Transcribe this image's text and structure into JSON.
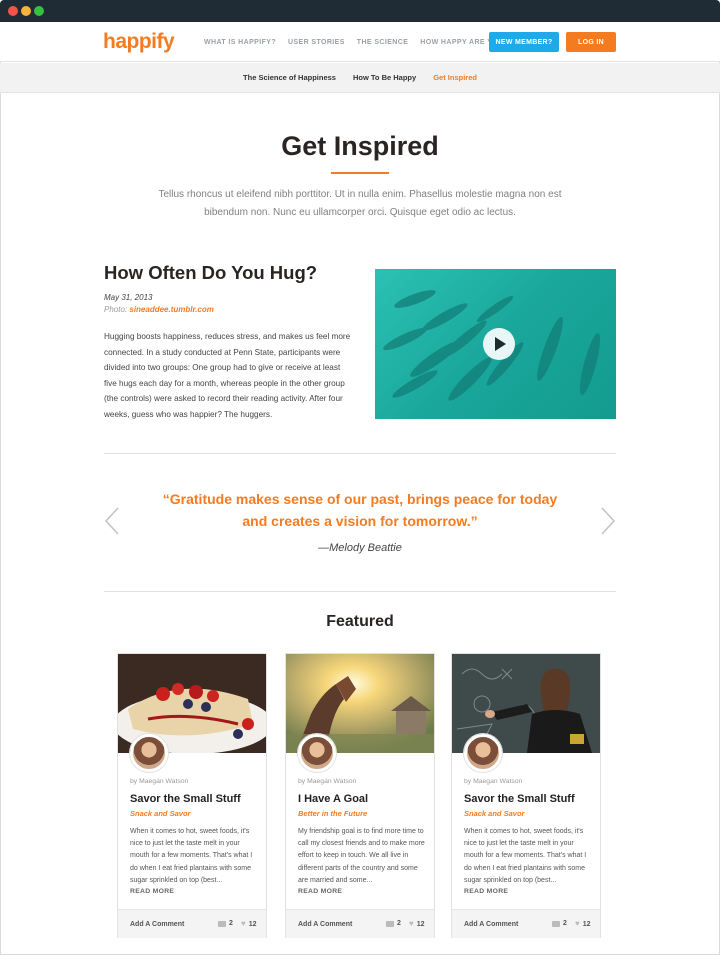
{
  "header": {
    "logo": "happify",
    "nav": [
      "WHAT IS HAPPIFY?",
      "USER STORIES",
      "THE SCIENCE",
      "HOW HAPPY ARE YOU?"
    ],
    "new_member_label": "NEW MEMBER?",
    "login_label": "LOG IN",
    "accent": "#f47b20",
    "blue": "#1ea9e8"
  },
  "subnav": [
    "The Science of Happiness",
    "How To Be Happy",
    "Get Inspired"
  ],
  "page": {
    "title": "Get Inspired",
    "intro": "Tellus rhoncus ut eleifend nibh porttitor. Ut in nulla enim. Phasellus molestie magna non est bibendum non. Nunc eu ullamcorper orci. Quisque eget odio ac lectus."
  },
  "article": {
    "title": "How Often Do You Hug?",
    "date": "May 31, 2013",
    "photo_label": "Photo:",
    "photo_credit": "sineaddee.tumblr.com",
    "body": "Hugging boosts happiness, reduces stress, and makes us feel more connected. In a study conducted at Penn State, participants were divided into two groups: One group had to give or receive at least five hugs each day for a month, whereas people in the other group (the controls) were asked to record their reading activity. After four weeks, guess who was happier? The huggers.",
    "video_icon": "play-icon"
  },
  "quote": {
    "text": "“Gratitude makes sense of our past, brings peace for today and creates a vision for tomorrow.”",
    "author": "—Melody Beattie"
  },
  "featured": {
    "title": "Featured",
    "cards": [
      {
        "by": "by Maegan Watson",
        "title": "Savor the Small Stuff",
        "category": "Snack and Savor",
        "excerpt": "When it comes to hot, sweet foods, it's nice to just let the taste melt in your mouth for a few moments. That's what I do when I eat fried plantains with some sugar sprinkled on top (best...",
        "more": "READ MORE",
        "comment_label": "Add A Comment",
        "comments": "2",
        "likes": "12"
      },
      {
        "by": "by Maegan Watson",
        "title": "I Have A Goal",
        "category": "Better in the Future",
        "excerpt": "My friendship goal is to find more time to call my closest friends and to make more effort to keep in touch. We all live in different parts of the country and some are married and some...",
        "more": "READ MORE",
        "comment_label": "Add A Comment",
        "comments": "2",
        "likes": "12"
      },
      {
        "by": "by Maegan Watson",
        "title": "Savor the Small Stuff",
        "category": "Snack and Savor",
        "excerpt": "When it comes to hot, sweet foods, it's nice to just let the taste melt in your mouth for a few moments. That's what I do when I eat fried plantains with some sugar sprinkled on top (best...",
        "more": "READ MORE",
        "comment_label": "Add A Comment",
        "comments": "2",
        "likes": "12"
      }
    ]
  }
}
